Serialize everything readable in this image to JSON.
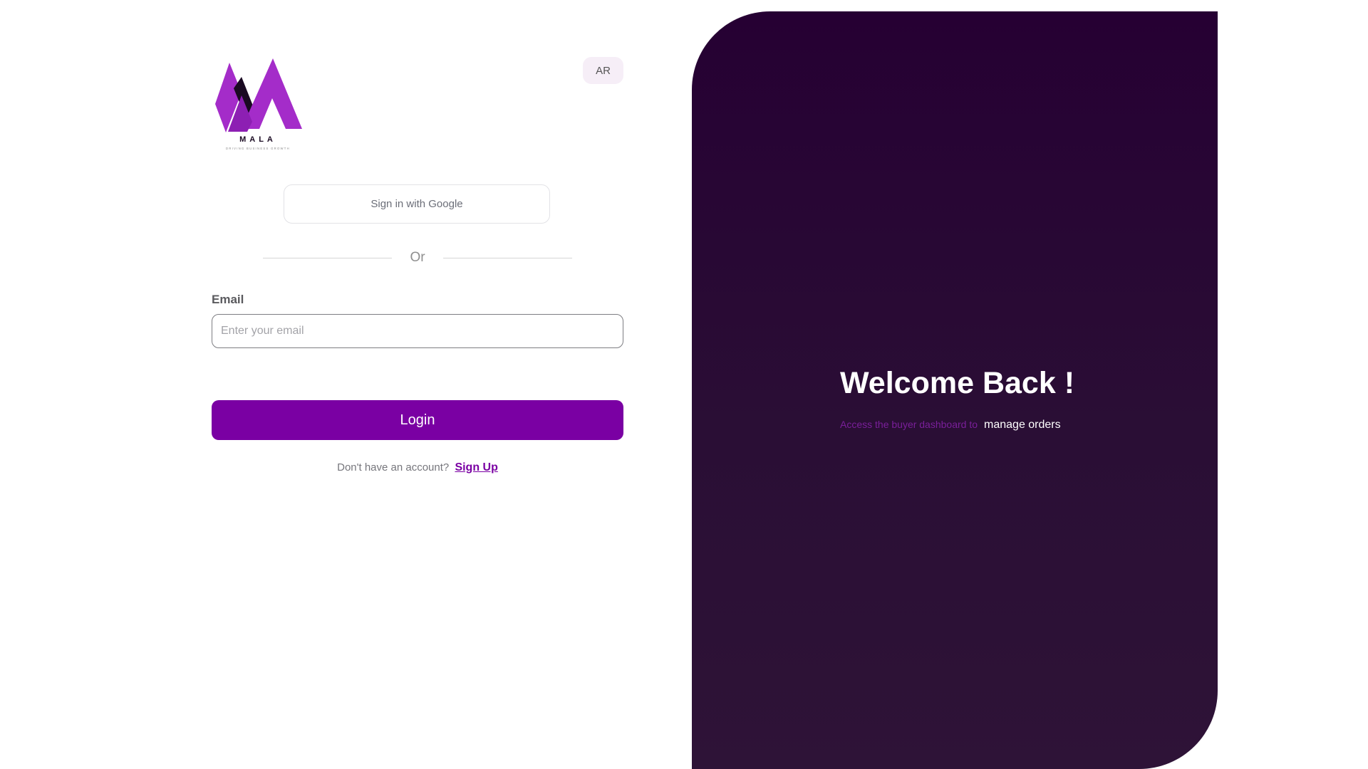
{
  "header": {
    "language_toggle": "AR",
    "logo": {
      "name": "MALA",
      "tagline": "DRIVING BUSINESS GROWTH"
    }
  },
  "auth": {
    "google_button": "Sign in with Google",
    "divider_text": "Or",
    "email": {
      "label": "Email",
      "placeholder": "Enter your email",
      "value": ""
    },
    "login_button": "Login",
    "signup_prompt": "Don't have an account?",
    "signup_link": "Sign Up"
  },
  "hero": {
    "title": "Welcome Back !",
    "subtitle_muted": "Access the buyer dashboard to",
    "subtitle_highlight": "manage orders"
  },
  "colors": {
    "brand_purple": "#7a00a3",
    "hero_background": "#260033",
    "logo_light": "#a42cc9",
    "logo_dark": "#1a0a22"
  }
}
